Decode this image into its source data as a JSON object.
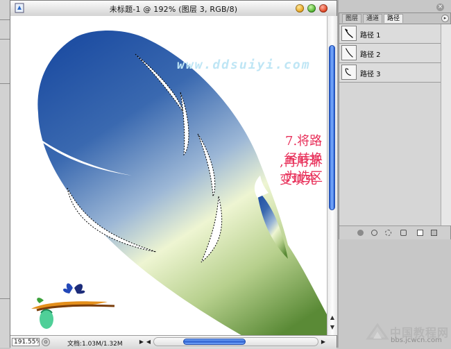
{
  "window": {
    "title": "未标题-1 @ 192% (图层 3, RGB/8)",
    "icon": "photoshop-document-icon"
  },
  "status": {
    "zoom": "191.55%",
    "doc_info": "文档:1.03M/1.32M"
  },
  "paths_panel": {
    "tabs": [
      {
        "label": "图层",
        "active": false
      },
      {
        "label": "通道",
        "active": false
      },
      {
        "label": "路径",
        "active": true
      }
    ],
    "paths": [
      {
        "label": "路径 1"
      },
      {
        "label": "路径 2"
      },
      {
        "label": "路径 3"
      }
    ],
    "footer_icons": [
      "fill-path-icon",
      "stroke-path-icon",
      "load-selection-icon",
      "make-work-path-icon",
      "new-path-icon",
      "delete-path-icon"
    ]
  },
  "canvas": {
    "watermark": "www.ddsuiyi.com",
    "annotation_line1": "7.将路径转换为选区",
    "annotation_line2": ",再用渐变填充",
    "colors": {
      "feather_top": "#1f4fa3",
      "feather_mid": "#9cb7d6",
      "feather_low": "#eef5d2",
      "feather_base": "#5a8a36",
      "note": "#e8305a"
    }
  },
  "site_badge": {
    "name": "中国教程网",
    "url": "bbs.jcwcn.com"
  }
}
